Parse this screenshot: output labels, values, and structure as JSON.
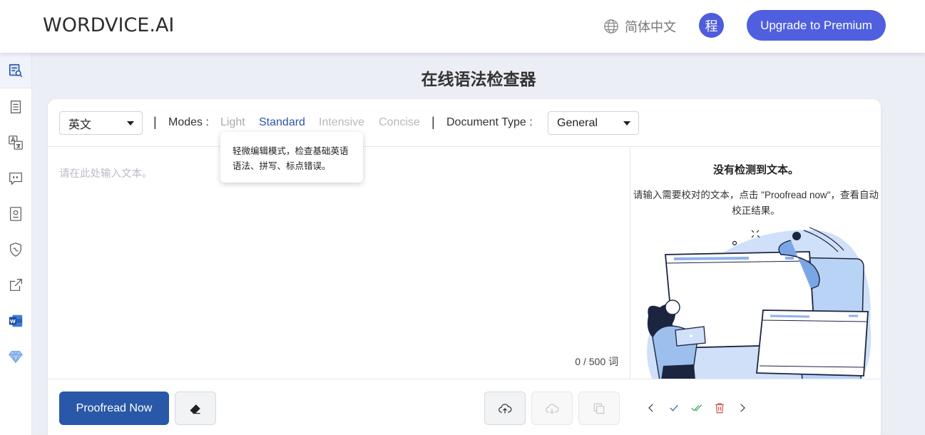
{
  "header": {
    "logo": "WORDVICE.AI",
    "language": "简体中文",
    "avatar_initial": "程",
    "premium_button": "Upgrade to Premium"
  },
  "sidebar": {
    "items": [
      {
        "name": "grammar-check",
        "icon": "document-search-icon",
        "active": true
      },
      {
        "name": "paraphrase",
        "icon": "list-document-icon"
      },
      {
        "name": "translate",
        "icon": "translate-icon"
      },
      {
        "name": "chat",
        "icon": "quote-bubble-icon"
      },
      {
        "name": "certificate",
        "icon": "certificate-icon"
      },
      {
        "name": "ai-detector",
        "icon": "shield-icon"
      },
      {
        "name": "external",
        "icon": "external-link-icon"
      },
      {
        "name": "word-addin",
        "icon": "word-icon"
      },
      {
        "name": "premium",
        "icon": "diamond-icon"
      }
    ]
  },
  "page": {
    "title": "在线语法检查器"
  },
  "toolbar": {
    "language_select": "英文",
    "separator": "|",
    "modes_label": "Modes :",
    "modes": [
      "Light",
      "Standard",
      "Intensive",
      "Concise"
    ],
    "selected_mode": "Standard",
    "doc_type_label": "Document Type :",
    "doc_type_select": "General"
  },
  "tooltip": {
    "text": "轻微编辑模式，检查基础英语语法、拼写、标点错误。"
  },
  "editor": {
    "placeholder": "请在此处输入文本。",
    "word_count": "0 / 500 词"
  },
  "results": {
    "title": "没有检测到文本。",
    "description": "请输入需要校对的文本，点击 \"Proofread now\"，查看自动校正结果。"
  },
  "bottom": {
    "proofread_button": "Proofread Now"
  },
  "colors": {
    "primary": "#2a58a8",
    "premium": "#4f5fe0",
    "accept_green": "#3aa655",
    "delete_red": "#d9534f"
  }
}
